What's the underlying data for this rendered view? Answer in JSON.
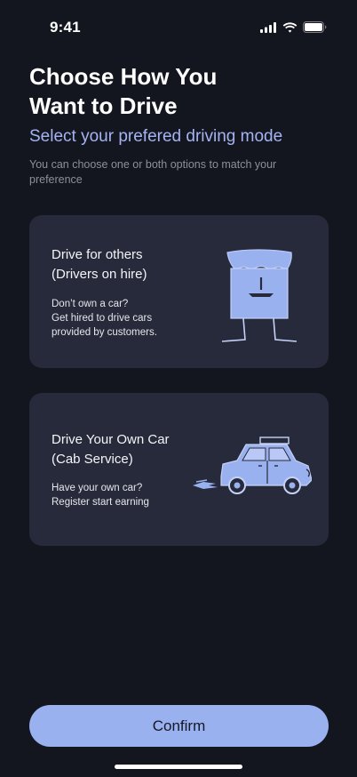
{
  "status_bar": {
    "time": "9:41",
    "icons": [
      "cellular-signal-icon",
      "wifi-icon",
      "battery-icon"
    ]
  },
  "header": {
    "title_line1": "Choose How You",
    "title_line2": "Want to Drive",
    "subtitle": "Select your prefered driving mode",
    "helper_text": "You can choose one or both options to match your preference"
  },
  "options": [
    {
      "title_line1": "Drive for others",
      "title_line2": "(Drivers on hire)",
      "desc_line1": "Don’t own a car?",
      "desc_line2": "Get hired to drive cars",
      "desc_line3": "provided by customers.",
      "illustration": "driver-illustration"
    },
    {
      "title_line1": "Drive Your Own Car",
      "title_line2": "(Cab Service)",
      "desc_line1": "Have your own car?",
      "desc_line2": "Register start earning",
      "illustration": "taxi-car-illustration"
    }
  ],
  "footer": {
    "confirm_label": "Confirm"
  },
  "colors": {
    "background": "#14161f",
    "card": "#262a3a",
    "accent": "#9ab1f0",
    "subtitle": "#a4b4f2"
  }
}
